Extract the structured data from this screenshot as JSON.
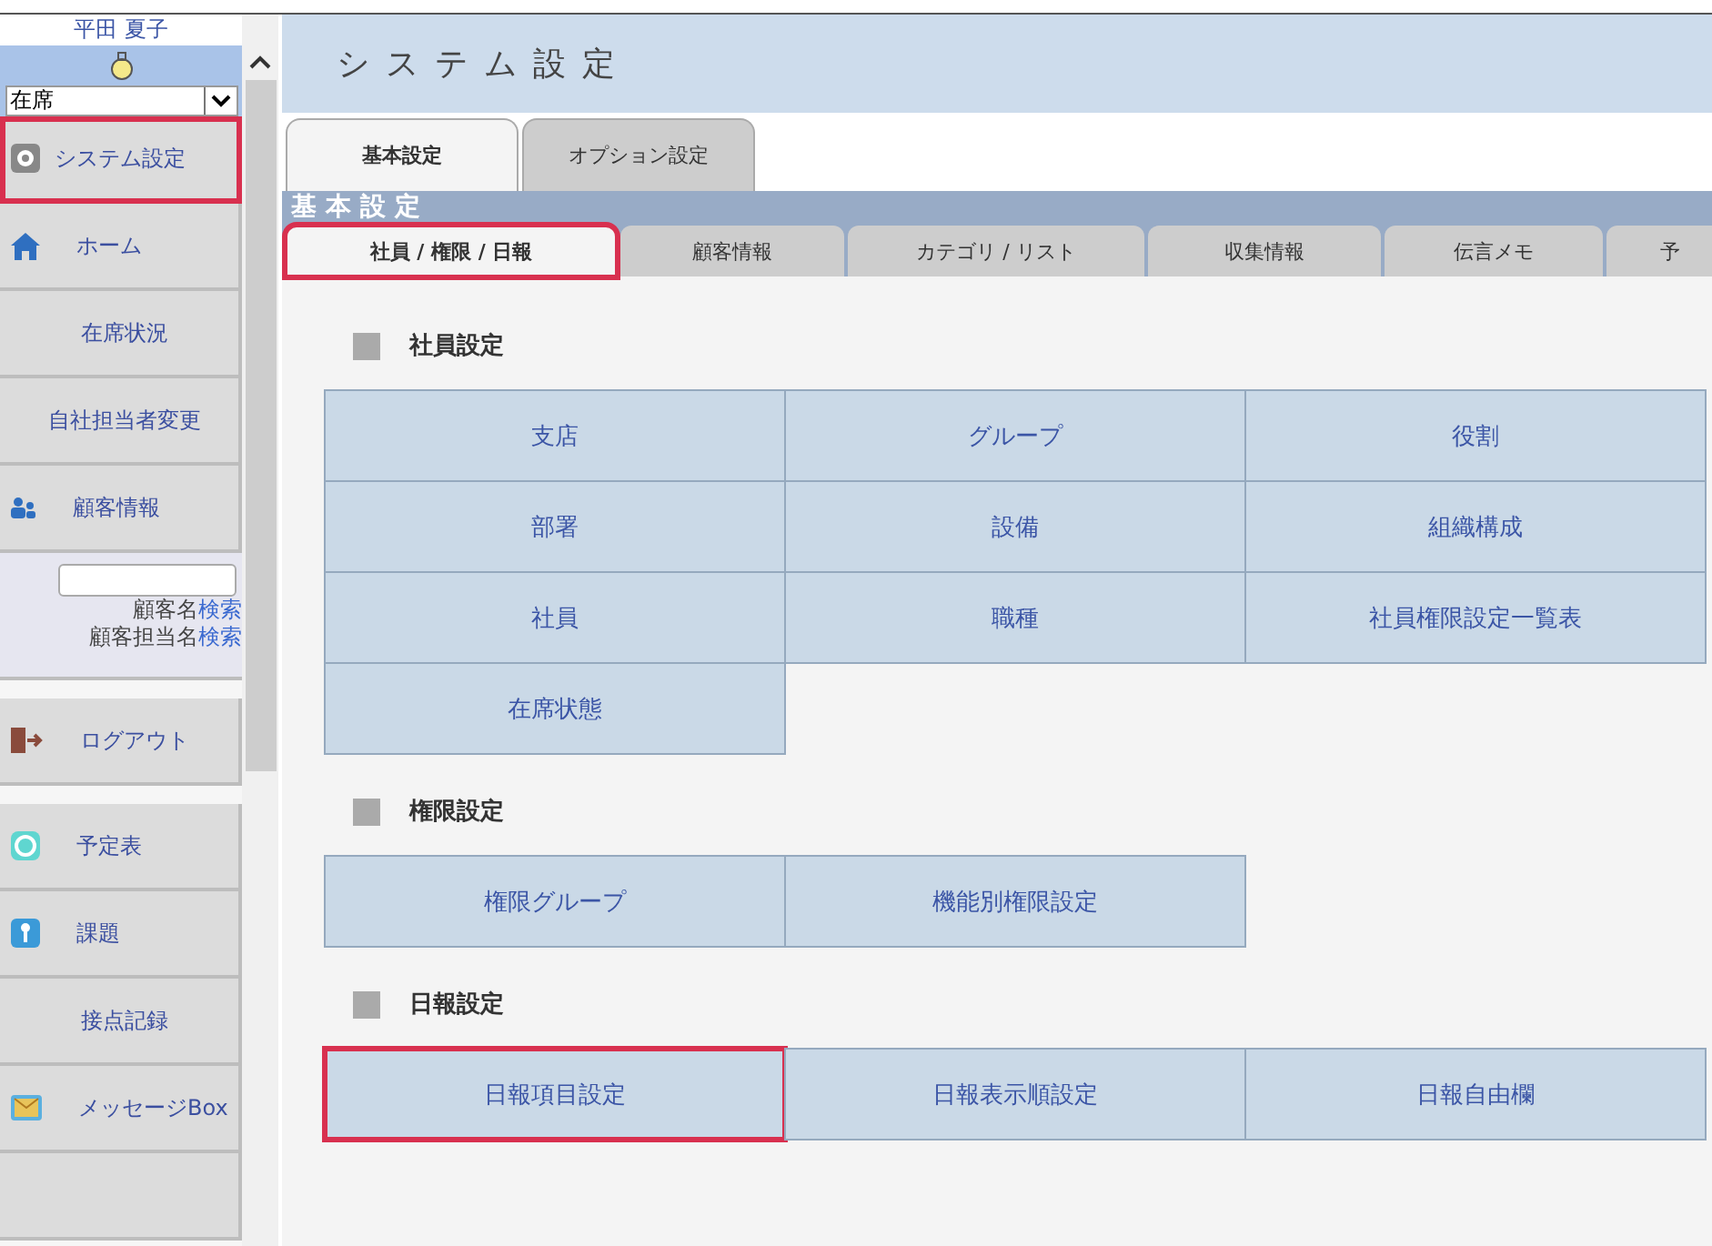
{
  "user": {
    "name": "平田 夏子",
    "status": "在席"
  },
  "sidebar": {
    "groups": [
      [
        {
          "kind": "nav",
          "label": "システム設定",
          "highlighted": true
        },
        {
          "kind": "nav",
          "label": "ホーム",
          "highlighted": false
        },
        {
          "kind": "nav",
          "label": "在席状況",
          "highlighted": false
        },
        {
          "kind": "nav",
          "label": "自社担当者変更",
          "highlighted": false
        },
        {
          "kind": "nav",
          "label": "顧客情報",
          "highlighted": false
        },
        {
          "kind": "search",
          "lines": [
            {
              "label": "顧客名",
              "link": "検索"
            },
            {
              "label": "顧客担当名",
              "link": "検索"
            }
          ]
        }
      ],
      [
        {
          "kind": "nav",
          "label": "ログアウト",
          "highlighted": false
        }
      ],
      [
        {
          "kind": "nav",
          "label": "予定表",
          "highlighted": false
        },
        {
          "kind": "nav",
          "label": "課題",
          "highlighted": false
        },
        {
          "kind": "nav",
          "label": "接点記録",
          "highlighted": false
        },
        {
          "kind": "nav",
          "label": "メッセージBox",
          "highlighted": false
        },
        {
          "kind": "nav",
          "highlighted": false
        }
      ]
    ]
  },
  "main": {
    "title": "システム設定",
    "tabs": [
      {
        "label": "基本設定",
        "selected": true
      },
      {
        "label": "オプション設定",
        "selected": false
      }
    ],
    "section_title": "基本設定",
    "subtabs": [
      {
        "label": "社員 / 権限 / 日報",
        "selected": true,
        "highlighted": true
      },
      {
        "label": "顧客情報",
        "selected": false,
        "highlighted": false
      },
      {
        "label": "カテゴリ / リスト",
        "selected": false,
        "highlighted": false
      },
      {
        "label": "収集情報",
        "selected": false,
        "highlighted": false
      },
      {
        "label": "伝言メモ",
        "selected": false,
        "highlighted": false
      },
      {
        "label": "予",
        "selected": false,
        "highlighted": false
      }
    ],
    "groups": [
      {
        "title": "社員設定",
        "cells": [
          {
            "label": "支店",
            "highlighted": false
          },
          {
            "label": "グループ",
            "highlighted": false
          },
          {
            "label": "役割",
            "highlighted": false
          },
          {
            "label": "部署",
            "highlighted": false
          },
          {
            "label": "設備",
            "highlighted": false
          },
          {
            "label": "組織構成",
            "highlighted": false
          },
          {
            "label": "社員",
            "highlighted": false
          },
          {
            "label": "職種",
            "highlighted": false
          },
          {
            "label": "社員権限設定一覧表",
            "highlighted": false
          },
          {
            "label": "在席状態",
            "highlighted": false
          }
        ]
      },
      {
        "title": "権限設定",
        "cells": [
          {
            "label": "権限グループ",
            "highlighted": false
          },
          {
            "label": "機能別権限設定",
            "highlighted": false
          }
        ]
      },
      {
        "title": "日報設定",
        "cells": [
          {
            "label": "日報項目設定",
            "highlighted": true
          },
          {
            "label": "日報表示順設定",
            "highlighted": false
          },
          {
            "label": "日報自由欄",
            "highlighted": false
          }
        ]
      }
    ]
  }
}
